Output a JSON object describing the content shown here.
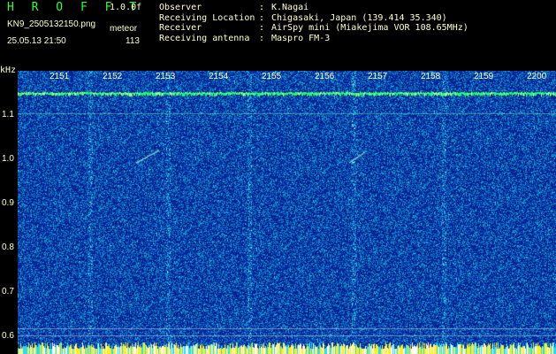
{
  "header": {
    "app_title": "H R O F F T",
    "version": "1.0.0f",
    "filename": "KN9_2505132150.png",
    "meteor_label": "meteor",
    "date_time": "25.05.13 21:50",
    "count": "113"
  },
  "info": [
    {
      "label": "Observer",
      "value": "K.Nagai"
    },
    {
      "label": "Receiving Location",
      "value": "Chigasaki, Japan (139.414 35.340)"
    },
    {
      "label": "Receiver",
      "value": "AirSpy mini (Miakejima VOR 108.65MHz)"
    },
    {
      "label": "Receiving antenna",
      "value": "Maspro FM-3"
    }
  ],
  "axes": {
    "y_unit": "kHz",
    "y_ticks": [
      "1.1",
      "1.0",
      "0.9",
      "0.8",
      "0.7",
      "0.6"
    ],
    "x_ticks": [
      "2151",
      "2152",
      "2153",
      "2154",
      "2155",
      "2156",
      "2157",
      "2158",
      "2159",
      "2200"
    ]
  },
  "colors": {
    "background": "#000000",
    "text": "#ffffcc",
    "title": "#33ff33",
    "plot_base": "#0a28a8",
    "reference_line": "#00ff55"
  }
}
